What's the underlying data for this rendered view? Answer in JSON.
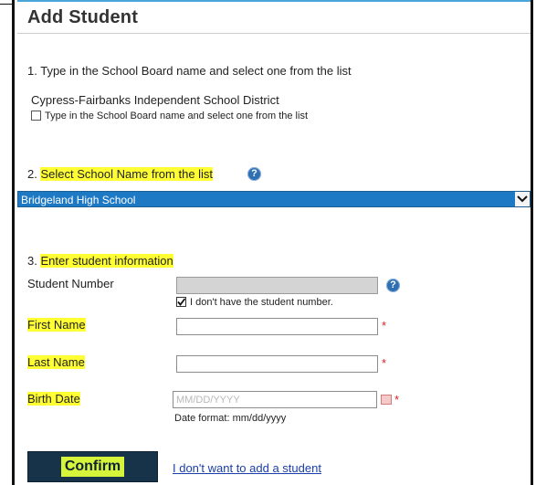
{
  "page": {
    "title": "Add Student"
  },
  "step1": {
    "instruction": "1. Type in the School Board name and select one from the list",
    "selected_board": "Cypress-Fairbanks Independent School District",
    "checkbox_label": "Type in the School Board name and select one from the list",
    "checkbox_checked": false
  },
  "step2": {
    "number": "2.",
    "instruction": "Select School Name from the list",
    "help_icon": "question-help-icon",
    "selected_school": "Bridgeland High School"
  },
  "step3": {
    "number": "3.",
    "instruction": "Enter student information",
    "student_number": {
      "label": "Student Number",
      "value": "",
      "no_number_label": "I don't have the student number.",
      "no_number_checked": true
    },
    "first_name": {
      "label": "First Name",
      "value": "",
      "required": "*"
    },
    "last_name": {
      "label": "Last Name",
      "value": "",
      "required": "*"
    },
    "birth_date": {
      "label": "Birth Date",
      "placeholder": "MM/DD/YYYY",
      "format_hint": "Date format: mm/dd/yyyy",
      "required": "*"
    }
  },
  "actions": {
    "confirm_label": "Confirm",
    "cancel_label": "I don't want to add a student"
  },
  "colors": {
    "highlight": "#ffff33",
    "select_bg": "#1e79c4",
    "button_bg": "#17334a",
    "button_label_bg": "#d6f53a",
    "required": "#e02020",
    "link": "#1a3fa8"
  }
}
